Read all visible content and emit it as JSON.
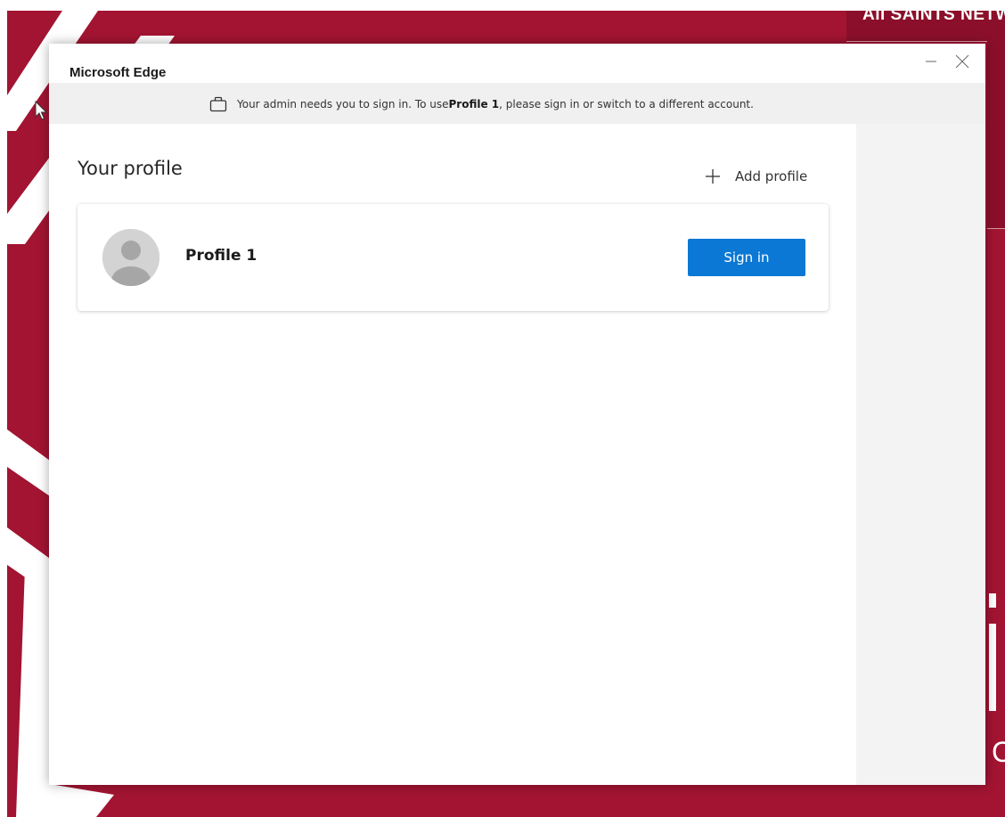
{
  "background": {
    "header_text": "All SAINTS NETWORK",
    "partial_letter": "C",
    "brand_color": "#a21432"
  },
  "dialog": {
    "app_title": "Microsoft Edge",
    "window_controls": {
      "minimize_icon": "minimize-icon",
      "close_icon": "close-icon"
    },
    "notice": {
      "icon": "briefcase-icon",
      "text_before": "Your admin needs you to sign in. To use ",
      "profile_bold": "Profile 1",
      "text_after": ", please sign in or switch to a different account."
    },
    "heading": "Your profile",
    "add_profile": {
      "icon": "plus-icon",
      "label": "Add profile"
    },
    "profile": {
      "avatar_icon": "default-avatar-icon",
      "name": "Profile 1",
      "sign_in_label": "Sign in"
    },
    "accent_color": "#0a78d4"
  }
}
